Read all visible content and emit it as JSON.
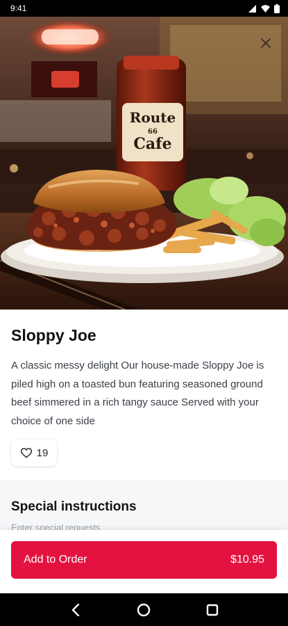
{
  "status_bar": {
    "time": "9:41"
  },
  "hero": {
    "image_alt": "Sloppy Joe sandwich on a plate with fries and lettuce beside a Route 66 Cafe sauce jar",
    "jar_label_line1": "Route",
    "jar_label_line2": "66",
    "jar_label_line3": "Cafe"
  },
  "item": {
    "title": "Sloppy Joe",
    "description": "A classic messy delight Our house-made Sloppy Joe is piled high on a toasted bun featuring seasoned ground beef simmered in a rich tangy sauce Served with your choice of one side",
    "likes": "19"
  },
  "special_instructions": {
    "title": "Special instructions",
    "placeholder": "Enter special requests"
  },
  "order_button": {
    "label": "Add to Order",
    "price": "$10.95"
  },
  "colors": {
    "accent": "#e4123f"
  }
}
